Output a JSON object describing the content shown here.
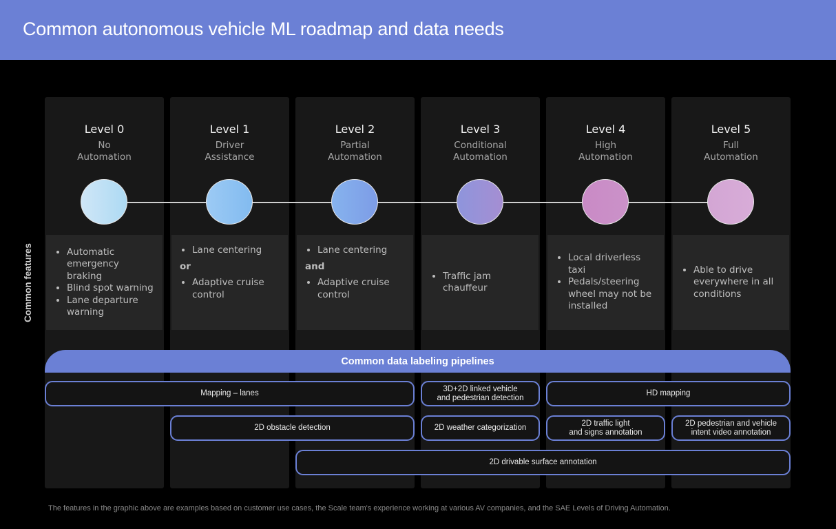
{
  "title": "Common autonomous vehicle ML roadmap and data needs",
  "side_label": "Common features",
  "levels": [
    {
      "title": "Level 0",
      "subtitle": [
        "No",
        "Automation"
      ],
      "color_from": "#cfe6f7",
      "color_to": "#addaf3",
      "features": {
        "items": [
          "Automatic emergency braking",
          "Blind spot warning",
          "Lane departure warning"
        ]
      }
    },
    {
      "title": "Level 1",
      "subtitle": [
        "Driver",
        "Assistance"
      ],
      "color_from": "#9ccaf4",
      "color_to": "#82bbf0",
      "features": {
        "items": [
          "Lane centering",
          "Adaptive cruise control"
        ],
        "conjunction": "or"
      }
    },
    {
      "title": "Level 2",
      "subtitle": [
        "Partial",
        "Automation"
      ],
      "color_from": "#86b3ee",
      "color_to": "#7d9ce6",
      "features": {
        "items": [
          "Lane centering",
          "Adaptive cruise control"
        ],
        "conjunction": "and"
      }
    },
    {
      "title": "Level 3",
      "subtitle": [
        "Conditional",
        "Automation"
      ],
      "color_from": "#8e95dc",
      "color_to": "#a58ed2",
      "features": {
        "items": [
          "Traffic jam chauffeur"
        ]
      }
    },
    {
      "title": "Level 4",
      "subtitle": [
        "High",
        "Automation"
      ],
      "color_from": "#c98ac6",
      "color_to": "#cb92c8",
      "features": {
        "items": [
          "Local driverless taxi",
          "Pedals/steering wheel may not be installed"
        ]
      }
    },
    {
      "title": "Level 5",
      "subtitle": [
        "Full",
        "Automation"
      ],
      "color_from": "#d3a6d4",
      "color_to": "#d8acd8",
      "features": {
        "items": [
          "Able to drive everywhere in all conditions"
        ]
      }
    }
  ],
  "pipelines": {
    "title": "Common data labeling pipelines",
    "items": [
      {
        "label": "Mapping – lanes",
        "from_level": 0,
        "to_level": 2,
        "row": 0
      },
      {
        "label": "3D+2D linked vehicle\nand pedestrian detection",
        "from_level": 3,
        "to_level": 3,
        "row": 0
      },
      {
        "label": "HD mapping",
        "from_level": 4,
        "to_level": 5,
        "row": 0
      },
      {
        "label": "2D obstacle detection",
        "from_level": 1,
        "to_level": 2,
        "row": 1
      },
      {
        "label": "2D weather categorization",
        "from_level": 3,
        "to_level": 3,
        "row": 1
      },
      {
        "label": "2D traffic light\nand signs annotation",
        "from_level": 4,
        "to_level": 4,
        "row": 1
      },
      {
        "label": "2D pedestrian and vehicle\nintent video annotation",
        "from_level": 5,
        "to_level": 5,
        "row": 1
      },
      {
        "label": "2D drivable surface annotation",
        "from_level": 2,
        "to_level": 5,
        "row": 2
      }
    ]
  },
  "footnote": "The features in the graphic above are examples based on customer use cases, the Scale team's experience working at various AV companies, and the SAE Levels of Driving Automation.",
  "colors": {
    "accent": "#6b80d5",
    "column_bg": "#181818",
    "feature_bg": "#262626",
    "page_bg": "#000000"
  }
}
